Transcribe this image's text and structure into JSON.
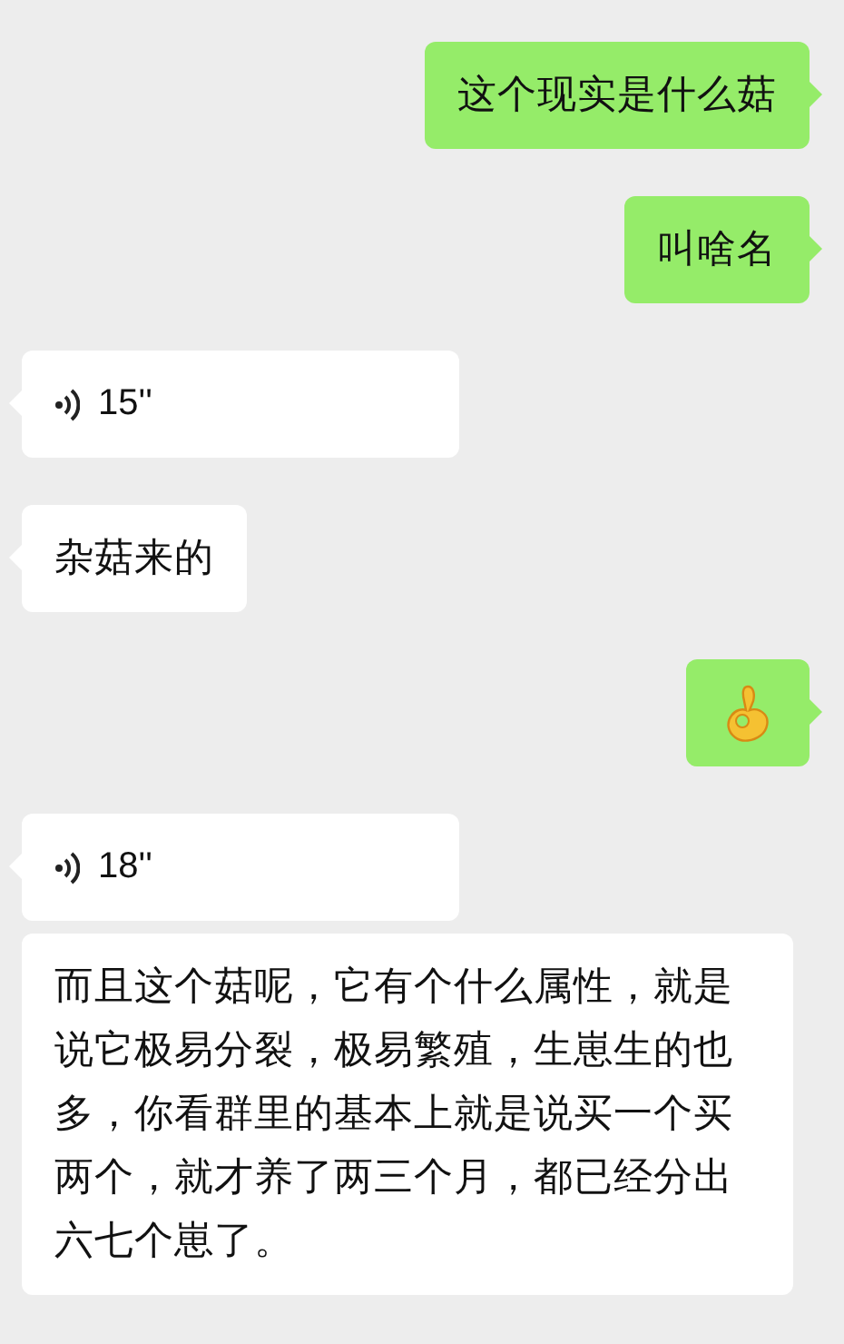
{
  "messages": [
    {
      "sent": true,
      "kind": "text",
      "text": "这个现实是什么菇",
      "tail": true
    },
    {
      "sent": true,
      "kind": "text",
      "text": "叫啥名",
      "tail": true
    },
    {
      "sent": false,
      "kind": "voice",
      "duration": "15''",
      "tail": true
    },
    {
      "sent": false,
      "kind": "text",
      "text": "杂菇来的",
      "tail": true
    },
    {
      "sent": true,
      "kind": "emoji",
      "tail": true
    },
    {
      "sent": false,
      "kind": "voice",
      "duration": "18''",
      "tail": true
    },
    {
      "sent": false,
      "kind": "text",
      "text": "而且这个菇呢，它有个什么属性，就是说它极易分裂，极易繁殖，生崽生的也多，你看群里的基本上就是说买一个买两个，就才养了两三个月，都已经分出六七个崽了。",
      "tail": false
    }
  ]
}
